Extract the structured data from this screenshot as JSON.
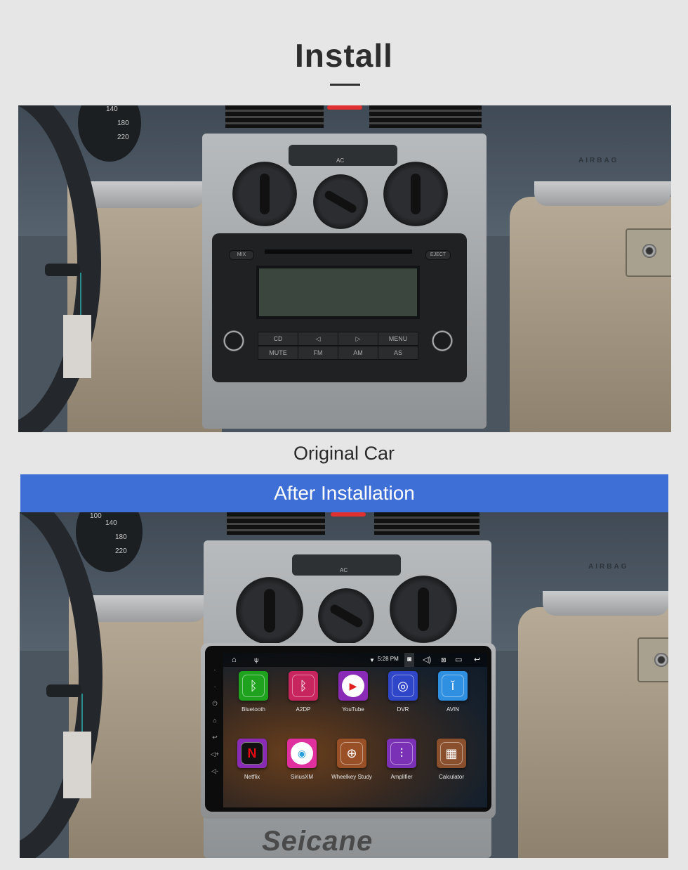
{
  "header": {
    "title": "Install"
  },
  "original": {
    "caption": "Original Car",
    "gauge_labels": [
      "140",
      "180",
      "220"
    ],
    "ac_label": "AC",
    "airbag_label": "AIRBAG",
    "radio": {
      "top_left": "MIX",
      "top_right": "EJECT",
      "buttons_row1": [
        "CD",
        "◁",
        "▷",
        "MENU"
      ],
      "buttons_row2": [
        "MUTE",
        "FM",
        "AM",
        "AS"
      ]
    }
  },
  "after": {
    "banner": "After Installation",
    "gauge_labels": [
      "100",
      "140",
      "180",
      "220"
    ],
    "ac_label": "AC",
    "airbag_label": "AIRBAG",
    "head_unit": {
      "status_bar": {
        "time": "5:28 PM",
        "icons": [
          "home-icon",
          "usb-icon",
          "wifi-icon",
          "screenshot-icon",
          "volume-icon",
          "close-app-icon",
          "recent-apps-icon",
          "back-icon"
        ]
      },
      "side_buttons": [
        "mic-icon",
        "reset-icon",
        "power-icon",
        "home-icon",
        "back-icon",
        "volume-up-icon",
        "volume-down-icon"
      ],
      "apps": [
        {
          "label": "Bluetooth",
          "icon": "bluetooth-icon",
          "color": "#1fa31f",
          "glyph": "ᛒ"
        },
        {
          "label": "A2DP",
          "icon": "bluetooth-audio-icon",
          "color": "#c8245e",
          "glyph": "ᛒ"
        },
        {
          "label": "YouTube",
          "icon": "youtube-icon",
          "color": "#8a2bb8",
          "glyph": "▶"
        },
        {
          "label": "DVR",
          "icon": "dvr-gauge-icon",
          "color": "#2f46c9",
          "glyph": "◎"
        },
        {
          "label": "AVIN",
          "icon": "avin-plug-icon",
          "color": "#2f8fe0",
          "glyph": "ǐ"
        },
        {
          "label": "Netflix",
          "icon": "netflix-icon",
          "color": "#8a2bb8",
          "glyph": "N"
        },
        {
          "label": "SiriusXM",
          "icon": "siriusxm-icon",
          "color": "#e02f9f",
          "glyph": "◉"
        },
        {
          "label": "Wheelkey Study",
          "icon": "steering-wheel-icon",
          "color": "#9a5026",
          "glyph": "⊕"
        },
        {
          "label": "Amplifier",
          "icon": "equalizer-icon",
          "color": "#7a31b5",
          "glyph": "⫶"
        },
        {
          "label": "Calculator",
          "icon": "calculator-icon",
          "color": "#8a4f2c",
          "glyph": "▦"
        }
      ]
    },
    "watermark": "Seicane"
  },
  "colors": {
    "background": "#e6e6e6",
    "banner": "#3e6fd6",
    "title": "#2d2d2d"
  }
}
